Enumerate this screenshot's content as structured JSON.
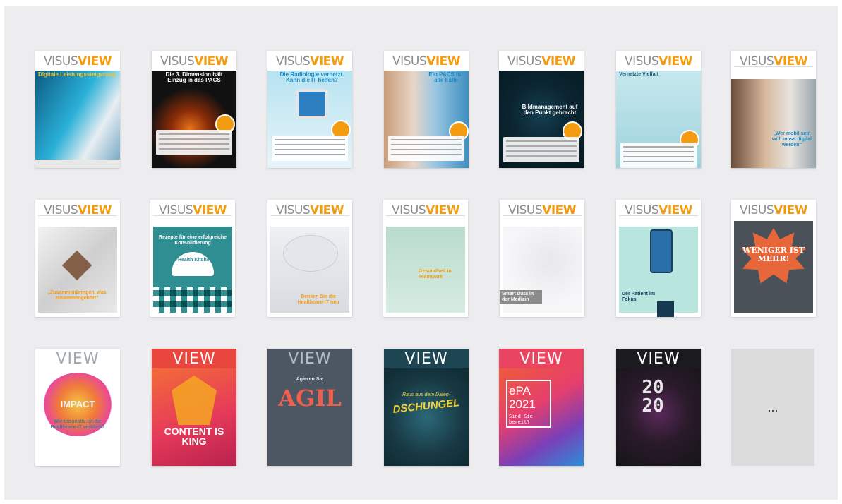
{
  "covers": [
    {
      "masthead_a": "VISUS",
      "masthead_b": "VIEW",
      "headline": "Digitale Leistungssteigerung"
    },
    {
      "masthead_a": "VISUS",
      "masthead_b": "VIEW",
      "headline": "Die 3. Dimension hält Einzug in das PACS"
    },
    {
      "masthead_a": "VISUS",
      "masthead_b": "VIEW",
      "headline": "Die Radiologie vernetzt. Kann die IT helfen?"
    },
    {
      "masthead_a": "VISUS",
      "masthead_b": "VIEW",
      "headline": "Ein PACS für alle Fälle"
    },
    {
      "masthead_a": "VISUS",
      "masthead_b": "VIEW",
      "headline": "Bildmanagement auf den Punkt gebracht"
    },
    {
      "masthead_a": "VISUS",
      "masthead_b": "VIEW",
      "headline": "Vernetzte Vielfalt"
    },
    {
      "masthead_a": "VISUS",
      "masthead_b": "VIEW",
      "headline": "„Wer mobil sein will, muss digital werden“"
    },
    {
      "masthead_a": "VISUS",
      "masthead_b": "VIEW",
      "headline": "„Zusammenbringen, was zusammengehört“"
    },
    {
      "masthead_a": "VISUS",
      "masthead_b": "VIEW",
      "headline": "Rezepte für eine erfolgreiche Konsolidierung",
      "sub": "E-Health Kitchen"
    },
    {
      "masthead_a": "VISUS",
      "masthead_b": "VIEW",
      "headline": "Denken Sie die Healthcare-IT neu"
    },
    {
      "masthead_a": "VISUS",
      "masthead_b": "VIEW",
      "headline": "Gesundheit in Teamwork"
    },
    {
      "masthead_a": "VISUS",
      "masthead_b": "VIEW",
      "headline": "Smart Data in der Medizin"
    },
    {
      "masthead_a": "VISUS",
      "masthead_b": "VIEW",
      "headline": "Der Patient im Fokus"
    },
    {
      "masthead_a": "VISUS",
      "masthead_b": "VIEW",
      "headline": "WENIGER IST MEHR!"
    },
    {
      "masthead": "VIEW",
      "headline": "IMPACT",
      "sub": "Wie innovativ ist die Healthcare-IT wirklich?"
    },
    {
      "masthead": "VIEW",
      "headline": "CONTENT IS KING"
    },
    {
      "masthead": "VIEW",
      "headline": "AGIL",
      "sub": "Agieren Sie"
    },
    {
      "masthead": "VIEW",
      "headline": "DSCHUNGEL",
      "sub": "Raus aus dem Daten-"
    },
    {
      "masthead": "VIEW",
      "headline": "ePA 2021",
      "sub": "Sind Sie bereit?"
    },
    {
      "masthead": "VIEW",
      "headline": "2020"
    }
  ],
  "more_label": "..."
}
